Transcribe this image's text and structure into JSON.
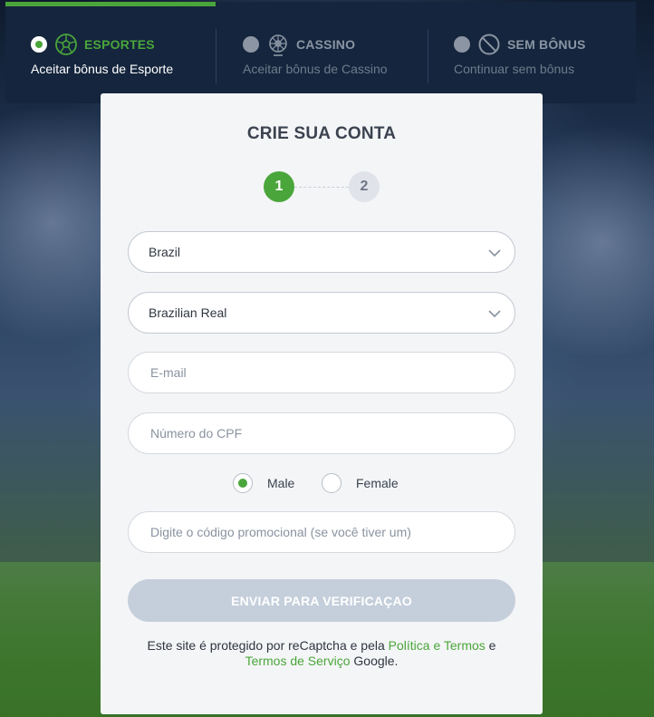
{
  "bonus_tabs": [
    {
      "title": "ESPORTES",
      "subtitle": "Aceitar bônus de Esporte",
      "icon": "soccer-ball-icon",
      "active": true
    },
    {
      "title": "CASSINO",
      "subtitle": "Aceitar bônus de Cassino",
      "icon": "roulette-icon",
      "active": false
    },
    {
      "title": "SEM BÔNUS",
      "subtitle": "Continuar sem bônus",
      "icon": "no-bonus-icon",
      "active": false
    }
  ],
  "form": {
    "title": "CRIE SUA CONTA",
    "steps": [
      "1",
      "2"
    ],
    "current_step": 1,
    "country": "Brazil",
    "currency": "Brazilian Real",
    "email_placeholder": "E-mail",
    "cpf_placeholder": "Número do CPF",
    "gender_options": [
      "Male",
      "Female"
    ],
    "gender_selected": "Male",
    "promo_placeholder": "Digite o código promocional (se você tiver um)",
    "submit_label": "ENVIAR PARA VERIFICAÇAO",
    "legal": {
      "text_1": "Este site é protegido por reCaptcha e pela ",
      "link_1": "Política e Termos",
      "text_2": " e ",
      "link_2": "Termos de Serviço",
      "text_3": " Google."
    }
  },
  "colors": {
    "accent": "#4aa63a",
    "panel": "#14253d",
    "card": "#f4f5f7",
    "button_disabled": "#c5cfdb"
  }
}
